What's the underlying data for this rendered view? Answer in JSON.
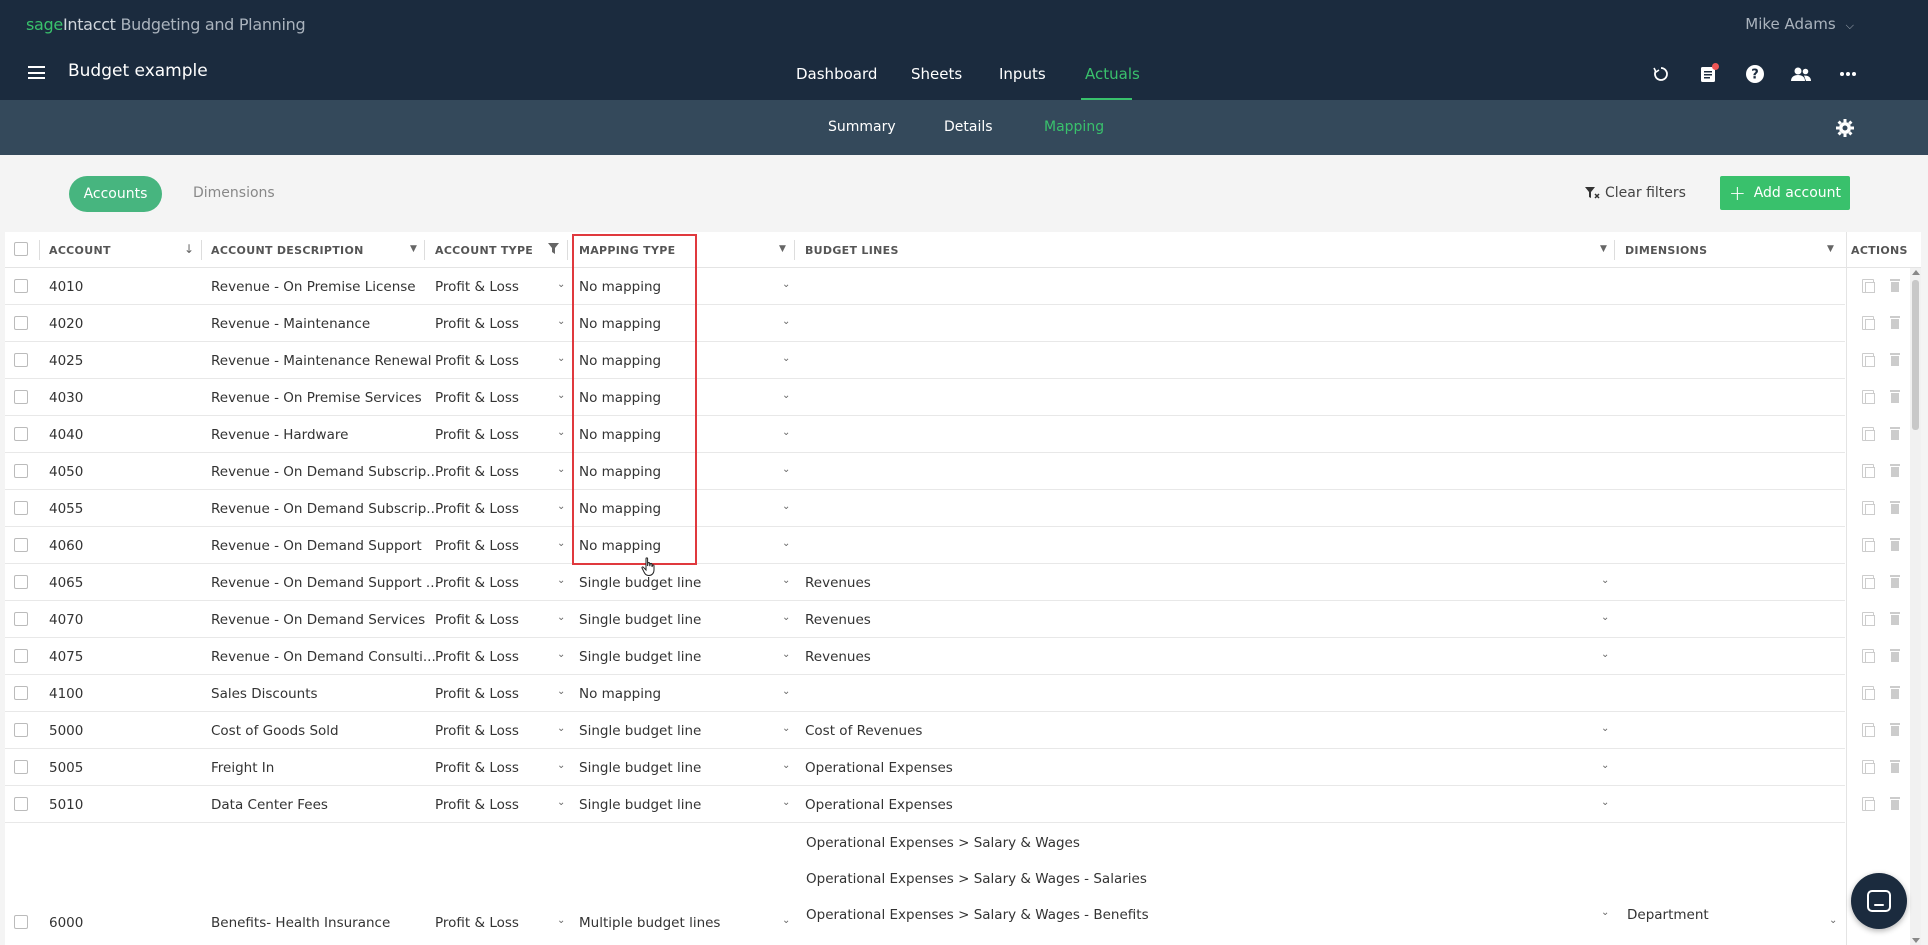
{
  "app": {
    "brand_sage": "sage",
    "brand_intacct": "Intacct",
    "brand_product": " Budgeting and Planning",
    "user_name": "Mike Adams",
    "project_title": "Budget example"
  },
  "main_nav": [
    {
      "label": "Dashboard",
      "active": false
    },
    {
      "label": "Sheets",
      "active": false
    },
    {
      "label": "Inputs",
      "active": false
    },
    {
      "label": "Actuals",
      "active": true
    }
  ],
  "sub_nav": [
    {
      "label": "Summary",
      "active": false
    },
    {
      "label": "Details",
      "active": false
    },
    {
      "label": "Mapping",
      "active": true
    }
  ],
  "toolbar": {
    "tab_accounts": "Accounts",
    "tab_dimensions": "Dimensions",
    "clear_filters": "Clear filters",
    "add_account": "Add account"
  },
  "table": {
    "headers": {
      "account": "ACCOUNT",
      "description": "ACCOUNT DESCRIPTION",
      "type": "ACCOUNT TYPE",
      "mapping": "MAPPING TYPE",
      "budget": "BUDGET LINES",
      "dimensions": "DIMENSIONS",
      "actions": "ACTIONS"
    },
    "rows": [
      {
        "account": "4010",
        "description": "Revenue - On Premise License",
        "type": "Profit & Loss",
        "mapping": "No mapping",
        "budget": ""
      },
      {
        "account": "4020",
        "description": "Revenue - Maintenance",
        "type": "Profit & Loss",
        "mapping": "No mapping",
        "budget": ""
      },
      {
        "account": "4025",
        "description": "Revenue - Maintenance Renewal",
        "type": "Profit & Loss",
        "mapping": "No mapping",
        "budget": ""
      },
      {
        "account": "4030",
        "description": "Revenue - On Premise Services",
        "type": "Profit & Loss",
        "mapping": "No mapping",
        "budget": ""
      },
      {
        "account": "4040",
        "description": "Revenue - Hardware",
        "type": "Profit & Loss",
        "mapping": "No mapping",
        "budget": ""
      },
      {
        "account": "4050",
        "description": "Revenue - On Demand Subscrip...",
        "type": "Profit & Loss",
        "mapping": "No mapping",
        "budget": ""
      },
      {
        "account": "4055",
        "description": "Revenue - On Demand Subscrip...",
        "type": "Profit & Loss",
        "mapping": "No mapping",
        "budget": ""
      },
      {
        "account": "4060",
        "description": "Revenue - On Demand Support",
        "type": "Profit & Loss",
        "mapping": "No mapping",
        "budget": ""
      },
      {
        "account": "4065",
        "description": "Revenue - On Demand Support ...",
        "type": "Profit & Loss",
        "mapping": "Single budget line",
        "budget": "Revenues"
      },
      {
        "account": "4070",
        "description": "Revenue - On Demand Services",
        "type": "Profit & Loss",
        "mapping": "Single budget line",
        "budget": "Revenues"
      },
      {
        "account": "4075",
        "description": "Revenue - On Demand Consulti...",
        "type": "Profit & Loss",
        "mapping": "Single budget line",
        "budget": "Revenues"
      },
      {
        "account": "4100",
        "description": "Sales Discounts",
        "type": "Profit & Loss",
        "mapping": "No mapping",
        "budget": ""
      },
      {
        "account": "5000",
        "description": "Cost of Goods Sold",
        "type": "Profit & Loss",
        "mapping": "Single budget line",
        "budget": "Cost of Revenues"
      },
      {
        "account": "5005",
        "description": "Freight In",
        "type": "Profit & Loss",
        "mapping": "Single budget line",
        "budget": "Operational Expenses"
      },
      {
        "account": "5010",
        "description": "Data Center Fees",
        "type": "Profit & Loss",
        "mapping": "Single budget line",
        "budget": "Operational Expenses"
      }
    ],
    "multi_row": {
      "account": "6000",
      "description": "Benefits- Health Insurance",
      "type": "Profit & Loss",
      "mapping": "Multiple budget lines",
      "budget_lines": [
        "Operational Expenses > Salary & Wages",
        "Operational Expenses > Salary & Wages - Salaries",
        "Operational Expenses > Salary & Wages - Benefits"
      ],
      "dimension": "Department"
    }
  }
}
